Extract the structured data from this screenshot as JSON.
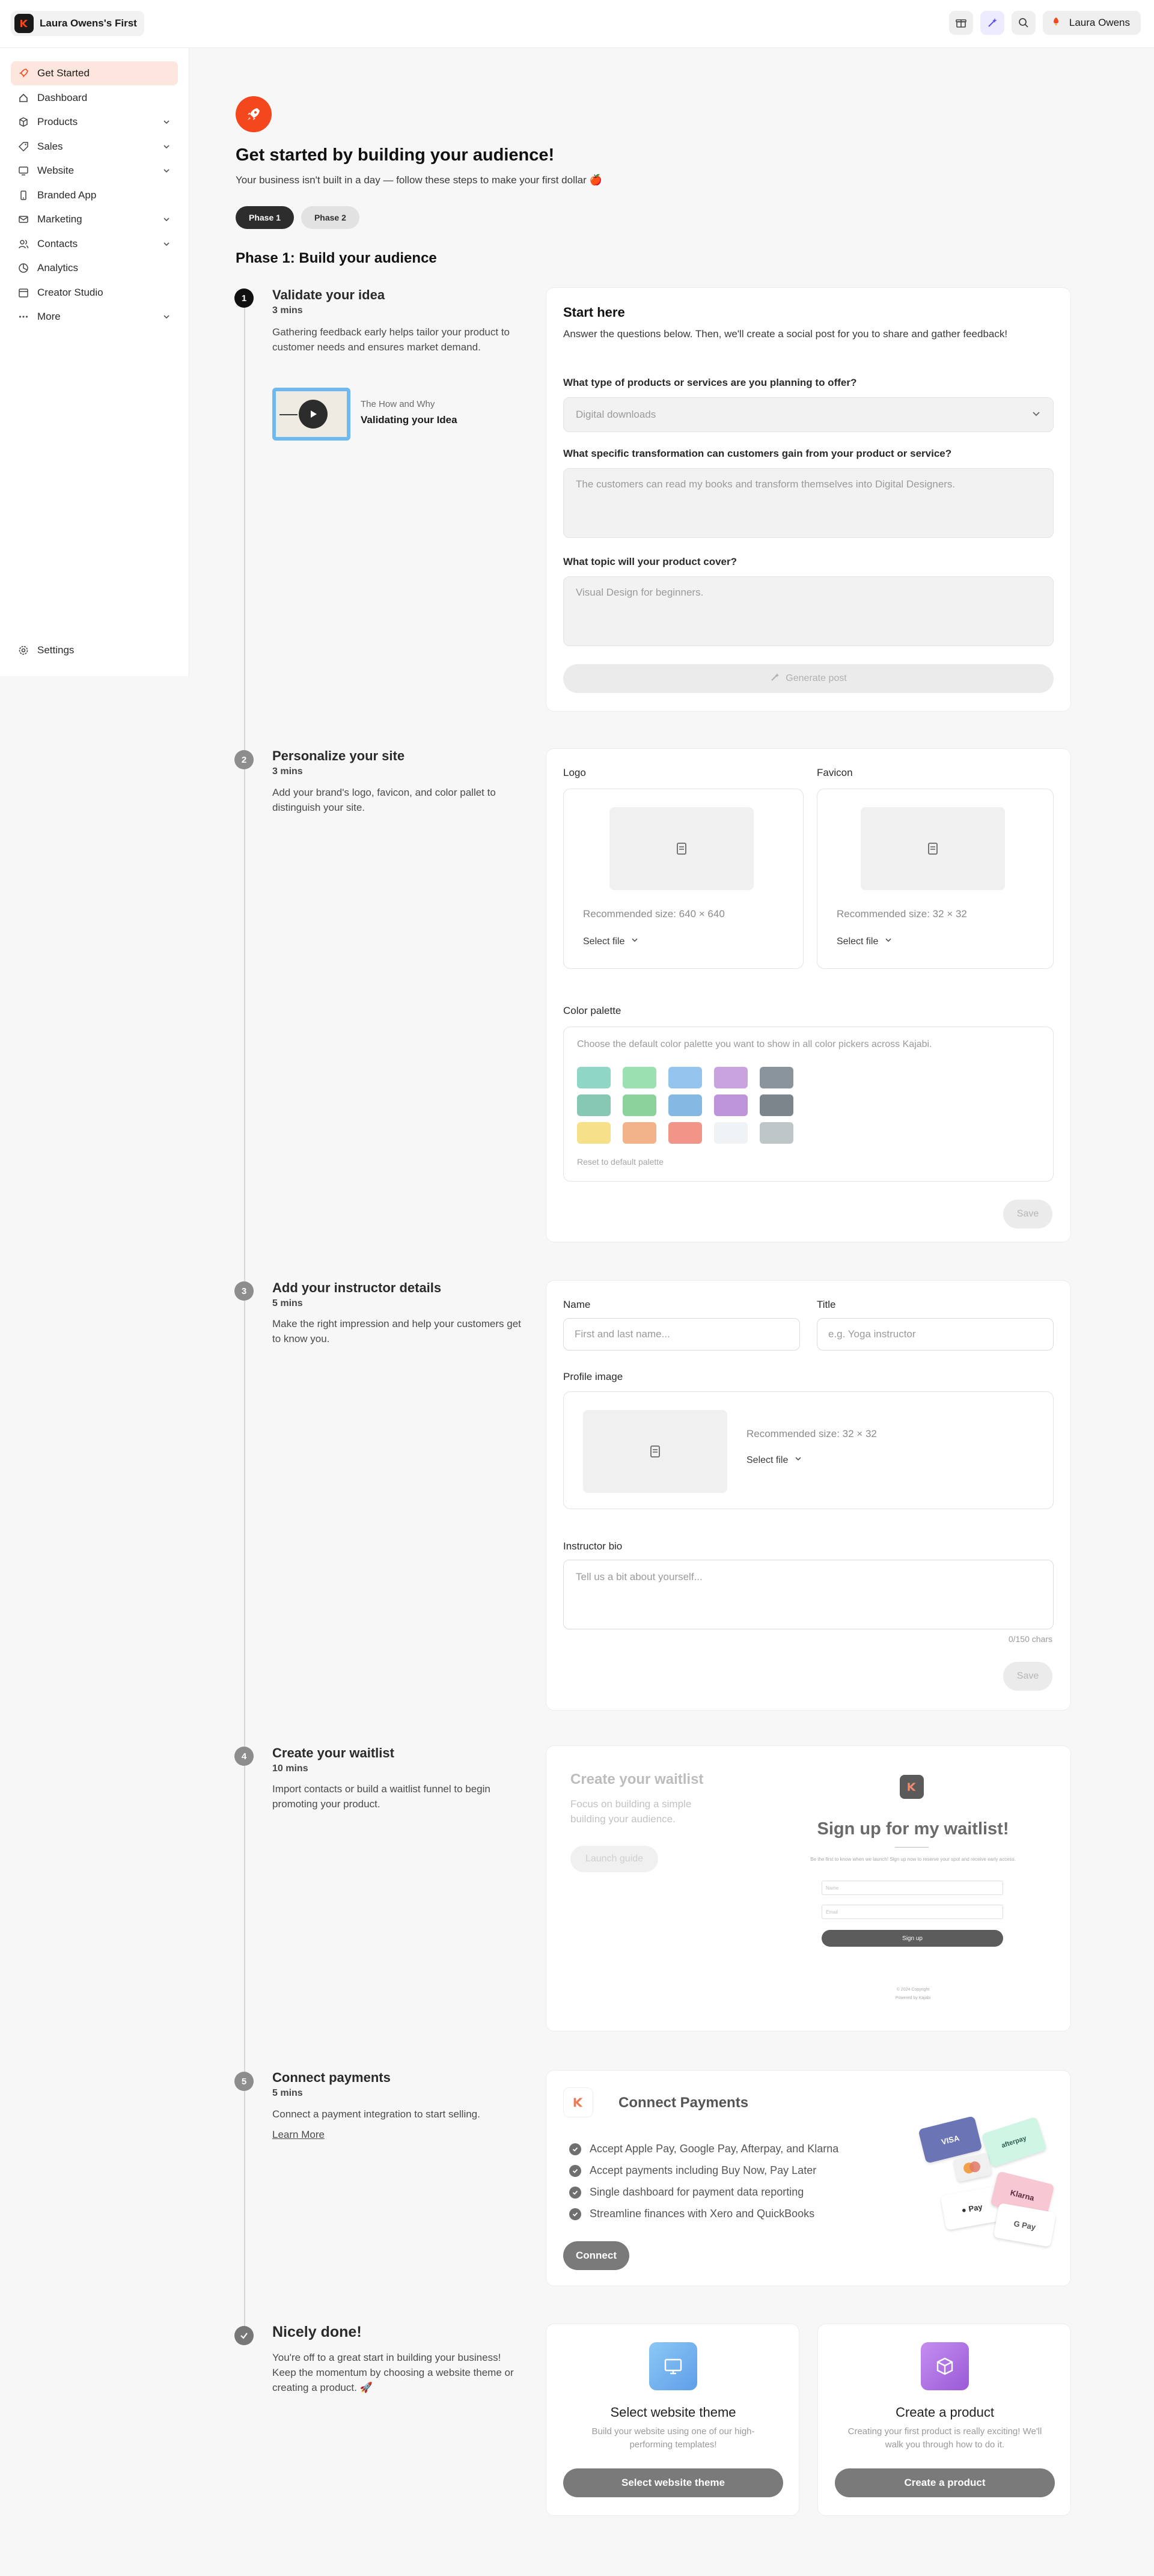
{
  "topbar": {
    "site_name": "Laura Owens's First",
    "user_name": "Laura Owens"
  },
  "sidebar": {
    "items": [
      {
        "label": "Get Started",
        "icon": "rocket-icon",
        "active": true,
        "chevron": false
      },
      {
        "label": "Dashboard",
        "icon": "dashboard-icon",
        "active": false,
        "chevron": false
      },
      {
        "label": "Products",
        "icon": "box-icon",
        "active": false,
        "chevron": true
      },
      {
        "label": "Sales",
        "icon": "tag-icon",
        "active": false,
        "chevron": true
      },
      {
        "label": "Website",
        "icon": "monitor-icon",
        "active": false,
        "chevron": true
      },
      {
        "label": "Branded App",
        "icon": "phone-icon",
        "active": false,
        "chevron": false
      },
      {
        "label": "Marketing",
        "icon": "mail-icon",
        "active": false,
        "chevron": true
      },
      {
        "label": "Contacts",
        "icon": "users-icon",
        "active": false,
        "chevron": true
      },
      {
        "label": "Analytics",
        "icon": "chart-icon",
        "active": false,
        "chevron": false
      },
      {
        "label": "Creator Studio",
        "icon": "calendar-icon",
        "active": false,
        "chevron": false
      },
      {
        "label": "More",
        "icon": "dots-icon",
        "active": false,
        "chevron": true
      }
    ],
    "settings_label": "Settings"
  },
  "hero": {
    "title": "Get started by building your audience!",
    "subtitle": "Your business isn't built in a day — follow these steps to make your first dollar 🍎"
  },
  "phases": {
    "tab1": "Phase 1",
    "tab2": "Phase 2",
    "heading": "Phase 1: Build your audience"
  },
  "step1": {
    "num": "1",
    "title": "Validate your idea",
    "time": "3 mins",
    "desc": "Gathering feedback early helps tailor your product to customer needs and ensures market demand.",
    "video_kicker": "The How and Why",
    "video_title": "Validating your Idea",
    "card_title": "Start here",
    "card_text": "Answer the questions below. Then, we'll create a social post for you to share and gather feedback!",
    "q1": "What type of products or services are you planning to offer?",
    "q1_value": "Digital downloads",
    "q2": "What specific transformation can customers gain from your product or service?",
    "q2_placeholder": "The customers can read my books and transform themselves into Digital Designers.",
    "q3": "What topic will your product cover?",
    "q3_placeholder": "Visual Design for beginners.",
    "generate_label": "Generate post"
  },
  "step2": {
    "num": "2",
    "title": "Personalize your site",
    "time": "3 mins",
    "desc": "Add your brand's logo, favicon, and color pallet to distinguish your site.",
    "logo_label": "Logo",
    "logo_rec": "Recommended size: 640 × 640",
    "favicon_label": "Favicon",
    "favicon_rec": "Recommended size: 32 × 32",
    "select_file": "Select file",
    "palette_label": "Color palette",
    "palette_hint": "Choose the default color palette you want to show in all color pickers across Kajabi.",
    "palette_reset": "Reset to default palette",
    "save": "Save",
    "swatches": [
      [
        "#8fd6c6",
        "#9ae0b0",
        "#95c4ee",
        "#c9a3e0",
        "#8a949c"
      ],
      [
        "#86c8b4",
        "#8cd29c",
        "#86b8e4",
        "#bd93da",
        "#7c858c"
      ],
      [
        "#f6e08a",
        "#f3b38a",
        "#f19588",
        "#f0f3f5",
        "#bfc6c8"
      ]
    ]
  },
  "step3": {
    "num": "3",
    "title": "Add your instructor details",
    "time": "5 mins",
    "desc": "Make the right impression and help your customers get to know you.",
    "name_label": "Name",
    "name_placeholder": "First and last name...",
    "title_label": "Title",
    "title_placeholder": "e.g. Yoga instructor",
    "profile_label": "Profile image",
    "profile_rec": "Recommended size: 32 × 32",
    "select_file": "Select file",
    "bio_label": "Instructor bio",
    "bio_placeholder": "Tell us a bit about yourself...",
    "char_count": "0/150 chars",
    "save": "Save"
  },
  "step4": {
    "num": "4",
    "title": "Create your waitlist",
    "time": "10 mins",
    "desc": "Import contacts or build a waitlist funnel to begin promoting your product.",
    "card_title": "Create your waitlist",
    "card_text": "Focus on building a simple building your audience.",
    "launch_label": "Launch guide",
    "preview_title": "Sign up for my waitlist!",
    "preview_sub": "Be the first to know when we launch! Sign up now to reserve your spot and receive early access.",
    "preview_field1": "Name",
    "preview_field2": "Email",
    "preview_button": "Sign up",
    "preview_footer1": "© 2024 Copyright",
    "preview_footer2": "Powered by Kajabi"
  },
  "step5": {
    "num": "5",
    "title": "Connect payments",
    "time": "5 mins",
    "desc": "Connect a payment integration to start selling.",
    "learn_more": "Learn More",
    "card_title": "Connect Payments",
    "bullets": [
      "Accept Apple Pay, Google Pay, Afterpay, and Klarna",
      "Accept payments including Buy Now, Pay Later",
      "Single dashboard for payment data reporting",
      "Streamline finances with Xero and QuickBooks"
    ],
    "connect_label": "Connect",
    "cards": [
      "VISA",
      "afterpay",
      "Pay",
      "Klarna",
      "G Pay"
    ]
  },
  "done": {
    "title": "Nicely done!",
    "desc": "You're off to a great start in building your business! Keep the momentum by choosing a website theme or creating a product. 🚀",
    "theme_title": "Select website theme",
    "theme_text": "Build your website using one of our high-performing templates!",
    "theme_button": "Select website theme",
    "product_title": "Create a product",
    "product_text": "Creating your first product is really exciting! We'll walk you through how to do it.",
    "product_button": "Create a product"
  },
  "colors": {
    "accent": "#f4471d",
    "active_nav_bg": "#fde6dd",
    "theme_icon_bg": "#6fb0f0",
    "product_icon_bg": "#a16bd8"
  }
}
